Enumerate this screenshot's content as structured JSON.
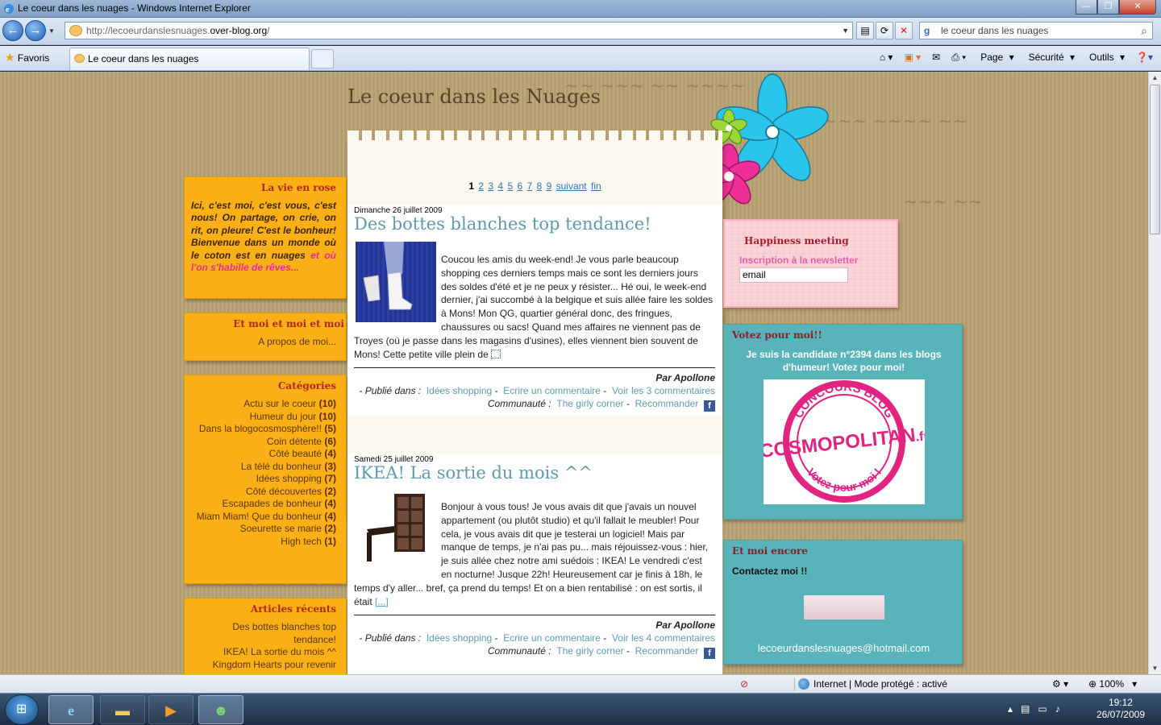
{
  "window": {
    "title": "Le coeur dans les nuages - Windows Internet Explorer"
  },
  "address": {
    "url_prefix": "http://lecoeurdanslesnuages.",
    "url_host": "over-blog.org",
    "url_suffix": "/"
  },
  "search": {
    "value": "le coeur dans les nuages"
  },
  "favorites": {
    "label": "Favoris"
  },
  "tab": {
    "label": "Le coeur dans les nuages"
  },
  "commands": {
    "page": "Page",
    "security": "Sécurité",
    "tools": "Outils"
  },
  "blog": {
    "title": "Le coeur dans les Nuages"
  },
  "left": {
    "vie_title": "La vie en rose",
    "intro_main": "Ici, c'est moi, c'est vous, c'est nous! On partage, on crie, on rit, on pleure! C'est le bonheur! Bienvenue dans un monde où le coton est en nuages ",
    "intro_pink": "et où l'on s'habille de rêves...",
    "moi_title": "Et moi et moi et moi",
    "apropos": "A propos de moi...",
    "cat_title": "Catégories",
    "categories": [
      {
        "name": "Actu sur le coeur",
        "count": "(10)"
      },
      {
        "name": "Humeur du jour",
        "count": "(10)"
      },
      {
        "name": "Dans la blogocosmosphère!!",
        "count": "(5)"
      },
      {
        "name": "Coin détente",
        "count": "(6)"
      },
      {
        "name": "Côté beauté",
        "count": "(4)"
      },
      {
        "name": "La télé du bonheur",
        "count": "(3)"
      },
      {
        "name": "Idées shopping",
        "count": "(7)"
      },
      {
        "name": "Côté découvertes",
        "count": "(2)"
      },
      {
        "name": "Escapades de bonheur",
        "count": "(4)"
      },
      {
        "name": "Miam Miam! Que du bonheur",
        "count": "(4)"
      },
      {
        "name": "Soeurette se marie",
        "count": "(2)"
      },
      {
        "name": "High tech",
        "count": "(1)"
      }
    ],
    "recent_title": "Articles récents",
    "recent": [
      "Des bottes blanches top tendance!",
      "IKEA! La sortie du mois ^^",
      "Kingdom Hearts pour revenir"
    ]
  },
  "pager": {
    "pages": [
      "1",
      "2",
      "3",
      "4",
      "5",
      "6",
      "7",
      "8",
      "9"
    ],
    "next": "suivant",
    "end": "fin"
  },
  "posts": [
    {
      "date": "Dimanche 26 juillet 2009",
      "title": "Des bottes blanches top tendance!",
      "body": "Coucou les amis du week-end! Je vous parle beaucoup shopping ces derniers temps mais ce sont les derniers jours des soldes d'été et je ne peux y résister... Hé oui, le week-end dernier, j'ai succombé à la belgique et suis allée faire les soldes à Mons! Mon QG, quartier général donc, des fringues, chaussures ou sacs! Quand mes affaires ne viennent pas de Troyes (où je passe dans les magasins d'usines), elles viennent bien souvent de Mons! Cette petite ville plein de ",
      "by": "Par Apollone",
      "published_label": "- Publié dans :",
      "category": "Idées shopping",
      "comment": "Ecrire un commentaire",
      "see_comments": "Voir les 3 commentaires",
      "community_label": "Communauté :",
      "community": "The girly corner",
      "recommend": "Recommander"
    },
    {
      "date": "Samedi 25 juillet 2009",
      "title": "IKEA! La sortie du mois ^^",
      "body": "Bonjour à vous tous! Je vous avais dit que j'avais un nouvel appartement (ou plutôt studio) et qu'il fallait le meubler! Pour cela, je vous avais dit que je testerai un logiciel! Mais par manque de temps, je n'ai pas pu... mais réjouissez-vous : hier, je suis allée chez notre ami suédois : IKEA! Le vendredi c'est en nocturne! Jusque 22h! Heureusement car je finis à 18h, le temps d'y aller... bref, ça prend du temps! Et on a bien rentabilisé : on est sortis, il était ",
      "more": "[...]",
      "by": "Par Apollone",
      "published_label": "- Publié dans :",
      "category": "Idées shopping",
      "comment": "Ecrire un commentaire",
      "see_comments": "Voir les 4 commentaires",
      "community_label": "Communauté :",
      "community": "The girly corner",
      "recommend": "Recommander"
    }
  ],
  "right": {
    "happy_title": "Happiness meeting",
    "newsletter": "Inscription à la newsletter",
    "email_value": "email",
    "vote_title": "Votez pour moi!!",
    "vote_text": "Je suis la candidate n°2394 dans les blogs d'humeur! Votez pour moi!",
    "cosmo_top": "CONCOURS BLOG",
    "cosmo_brand": "COSMOPOLITAN",
    "cosmo_tld": ".fr",
    "cosmo_bottom": "Votez pour moi !",
    "encore_title": "Et moi encore",
    "contact": "Contactez moi !!",
    "email": "lecoeurdanslesnuages@hotmail.com"
  },
  "status": {
    "zone": "Internet | Mode protégé : activé",
    "zoom": "100%"
  },
  "clock": {
    "time": "19:12",
    "date": "26/07/2009"
  },
  "colors": {
    "page_bg": "#b9a374",
    "orange_box": "#fab016",
    "teal_box": "#59b3ba",
    "pink_box": "#fbd4d9",
    "link": "#5f9aad",
    "brand_pink": "#e0247f"
  }
}
